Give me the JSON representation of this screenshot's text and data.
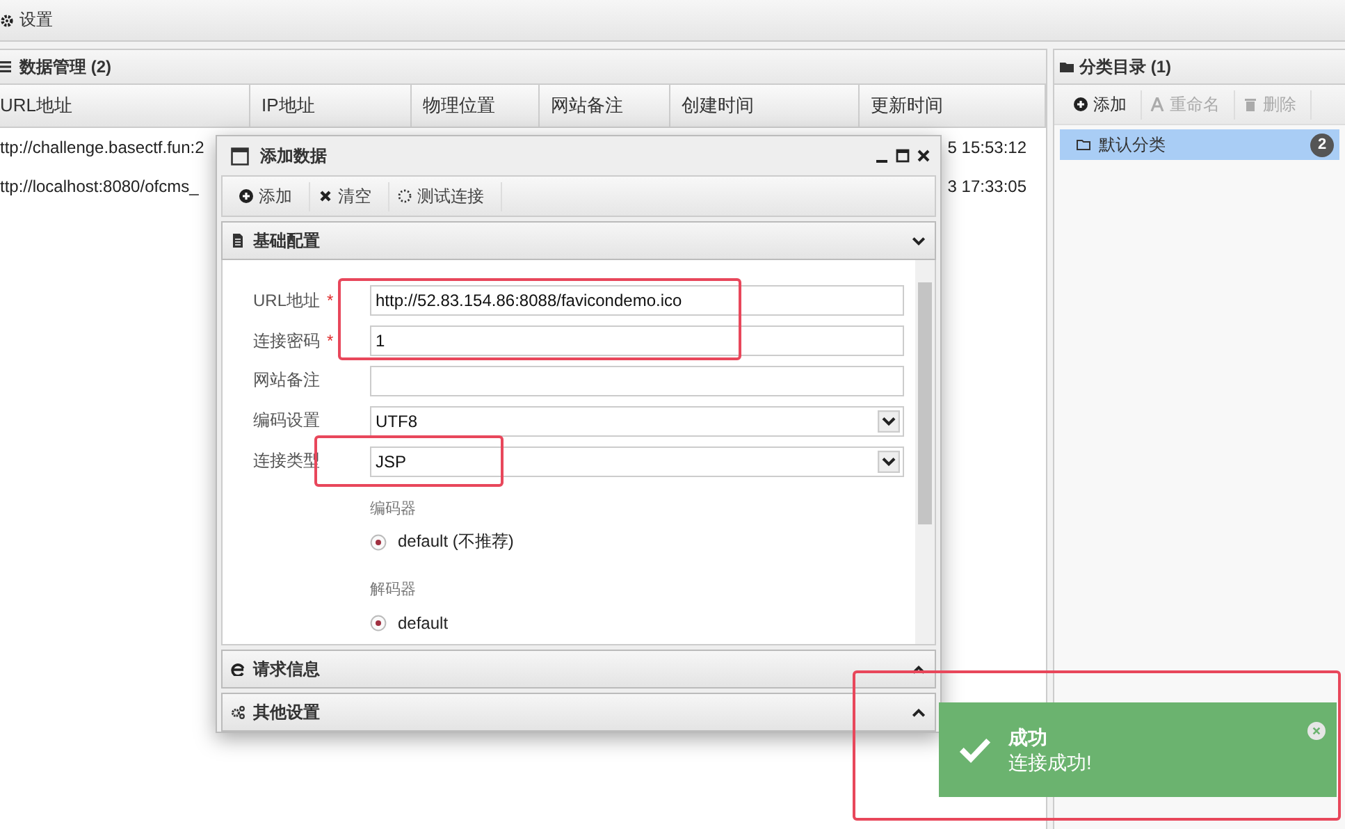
{
  "menu_bar": {
    "items": [
      {
        "label": "设置"
      }
    ]
  },
  "data_panel": {
    "title": "数据管理 (2)",
    "columns": [
      "URL地址",
      "IP地址",
      "物理位置",
      "网站备注",
      "创建时间",
      "更新时间"
    ],
    "rows": [
      {
        "url": "ttp://challenge.basectf.fun:2",
        "updated": "5 15:53:12",
        "selected": false
      },
      {
        "url": "ttp://localhost:8080/ofcms_",
        "updated": "3 17:33:05",
        "selected": false
      }
    ]
  },
  "category_panel": {
    "title": "分类目录 (1)",
    "toolbar": [
      {
        "label": "添加",
        "disabled": false
      },
      {
        "label": "重命名",
        "disabled": true
      },
      {
        "label": "删除",
        "disabled": true
      }
    ],
    "items": [
      {
        "label": "默认分类",
        "count": "2",
        "selected": true
      }
    ]
  },
  "dialog": {
    "title": "添加数据",
    "toolbar": [
      {
        "label": "添加"
      },
      {
        "label": "清空"
      },
      {
        "label": "测试连接"
      }
    ],
    "sections": [
      {
        "title": "基础配置",
        "expanded": true
      },
      {
        "title": "请求信息",
        "expanded": false
      },
      {
        "title": "其他设置",
        "expanded": false
      }
    ],
    "fields": [
      {
        "label": "URL地址",
        "kind": "text",
        "required_mark": "*",
        "value": "http://52.83.154.86:8088/favicondemo.ico"
      },
      {
        "label": "连接密码",
        "kind": "text",
        "required_mark": "*",
        "value": "1"
      },
      {
        "label": "网站备注",
        "kind": "text"
      },
      {
        "label": "编码设置",
        "kind": "select",
        "value": "UTF8"
      },
      {
        "label": "连接类型",
        "kind": "select",
        "value": "JSP"
      }
    ],
    "encoder": {
      "title": "编码器",
      "options": [
        {
          "label": "default (不推荐)",
          "selected": true
        }
      ]
    },
    "decoder": {
      "title": "解码器",
      "options": [
        {
          "label": "default",
          "selected": true
        }
      ]
    }
  },
  "toast": {
    "title": "成功",
    "message": "连接成功!"
  }
}
